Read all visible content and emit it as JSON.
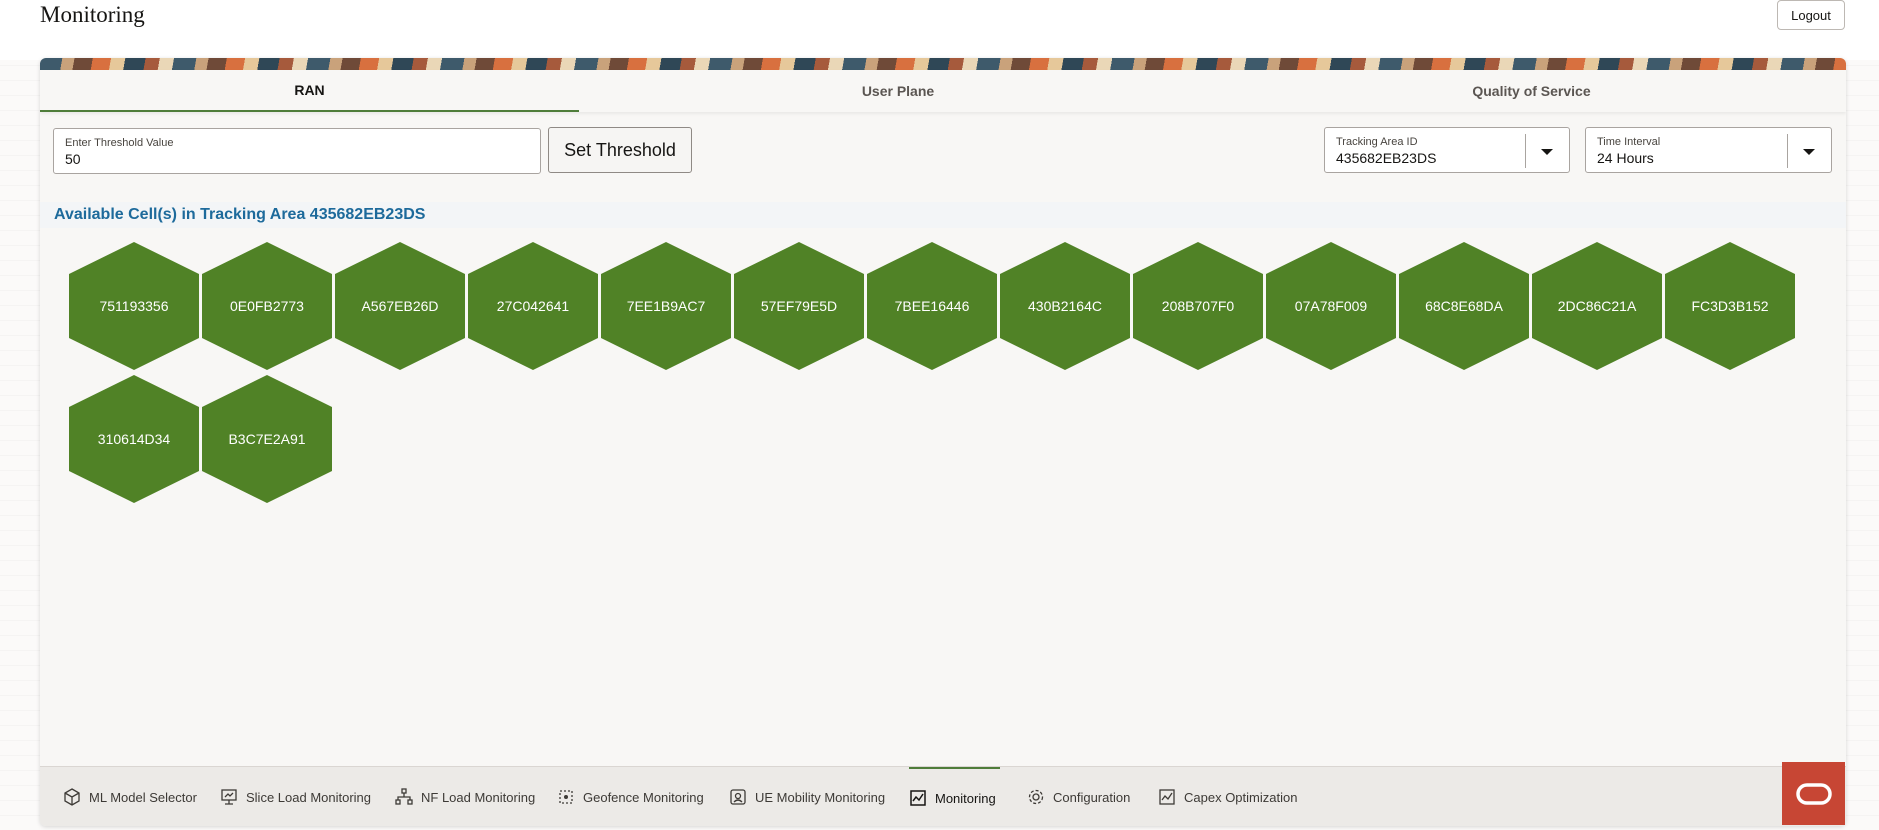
{
  "header": {
    "title": "Monitoring",
    "logout_label": "Logout"
  },
  "tabs": [
    {
      "label": "RAN",
      "active": true
    },
    {
      "label": "User Plane",
      "active": false
    },
    {
      "label": "Quality of Service",
      "active": false
    }
  ],
  "threshold": {
    "label": "Enter Threshold Value",
    "value": "50",
    "button_label": "Set Threshold"
  },
  "tracking_area": {
    "label": "Tracking Area ID",
    "value": "435682EB23DS"
  },
  "time_interval": {
    "label": "Time Interval",
    "value": "24 Hours"
  },
  "section_title": "Available Cell(s) in Tracking Area 435682EB23DS",
  "cells": [
    "751193356",
    "0E0FB2773",
    "A567EB26D",
    "27C042641",
    "7EE1B9AC7",
    "57EF79E5D",
    "7BEE16446",
    "430B2164C",
    "208B707F0",
    "07A78F009",
    "68C8E68DA",
    "2DC86C21A",
    "FC3D3B152",
    "310614D34",
    "B3C7E2A91"
  ],
  "cell_color": "#508226",
  "accent_color": "#4f7d3a",
  "bottom_nav": [
    {
      "label": "ML Model Selector",
      "icon": "cube-icon",
      "active": false
    },
    {
      "label": "Slice Load Monitoring",
      "icon": "monitor-icon",
      "active": false
    },
    {
      "label": "NF Load Monitoring",
      "icon": "network-icon",
      "active": false
    },
    {
      "label": "Geofence Monitoring",
      "icon": "geofence-icon",
      "active": false
    },
    {
      "label": "UE Mobility Monitoring",
      "icon": "device-icon",
      "active": false
    },
    {
      "label": "Monitoring",
      "icon": "chart-icon",
      "active": true
    },
    {
      "label": "Configuration",
      "icon": "gear-icon",
      "active": false
    },
    {
      "label": "Capex Optimization",
      "icon": "capex-chart-icon",
      "active": false
    }
  ]
}
